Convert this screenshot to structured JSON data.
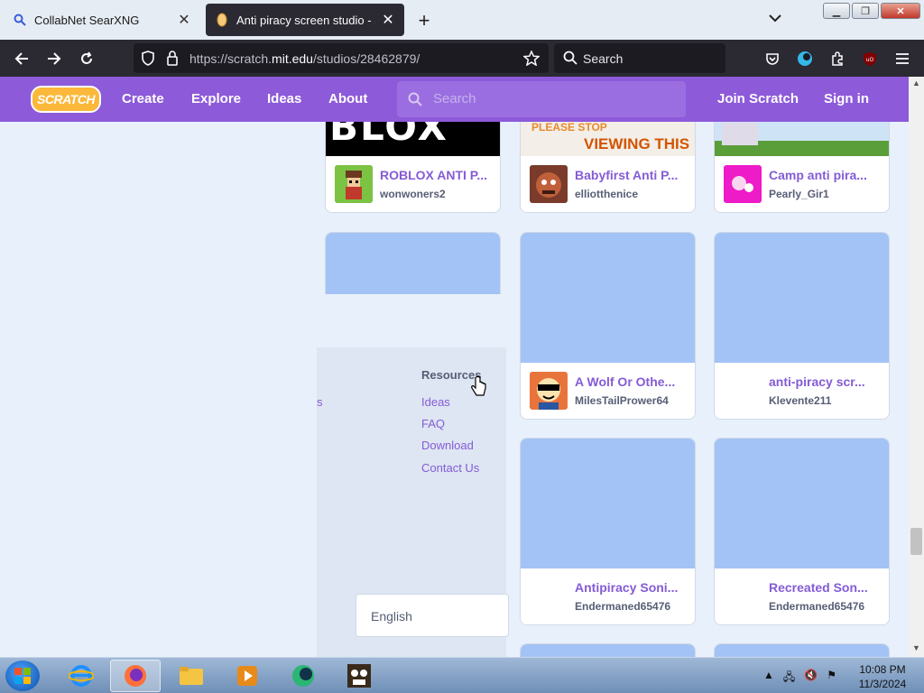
{
  "browser": {
    "tabs": [
      {
        "title": "CollabNet SearXNG",
        "active": false
      },
      {
        "title": "Anti piracy screen studio - Scratch",
        "active": true
      }
    ],
    "url_prefix": "https://scratch.",
    "url_domain": "mit.edu",
    "url_path": "/studios/28462879/",
    "search_placeholder": "Search"
  },
  "scratch_nav": {
    "logo": "SCRATCH",
    "links": [
      "Create",
      "Explore",
      "Ideas",
      "About"
    ],
    "search_placeholder": "Search",
    "join": "Join Scratch",
    "signin": "Sign in"
  },
  "projects": [
    {
      "title": "ROBLOX ANTI P...",
      "author": "wonwoners2"
    },
    {
      "title": "Babyfirst Anti P...",
      "author": "elliotthenice"
    },
    {
      "title": "Camp anti pira...",
      "author": "Pearly_Gir1"
    },
    {
      "title": "A Wolf Or Othe...",
      "author": "MilesTailPrower64"
    },
    {
      "title": "anti-piracy scr...",
      "author": "Klevente211"
    },
    {
      "title": "Antipiracy Soni...",
      "author": "Endermaned65476"
    },
    {
      "title": "Recreated Son...",
      "author": "Endermaned65476"
    }
  ],
  "thumb_texts": {
    "roblox": "BLOX",
    "please_stop": "PLEASE STOP",
    "viewing_this": "VIEWING THIS"
  },
  "footer": {
    "resources_heading": "Resources",
    "fragment": "s",
    "links": [
      "Ideas",
      "FAQ",
      "Download",
      "Contact Us"
    ],
    "language": "English"
  },
  "taskbar": {
    "time": "10:08 PM",
    "date": "11/3/2024"
  },
  "colors": {
    "scratch_purple": "#8d5ad9",
    "link_purple": "#855cd6",
    "thumb_blue": "#a3c3f6"
  }
}
